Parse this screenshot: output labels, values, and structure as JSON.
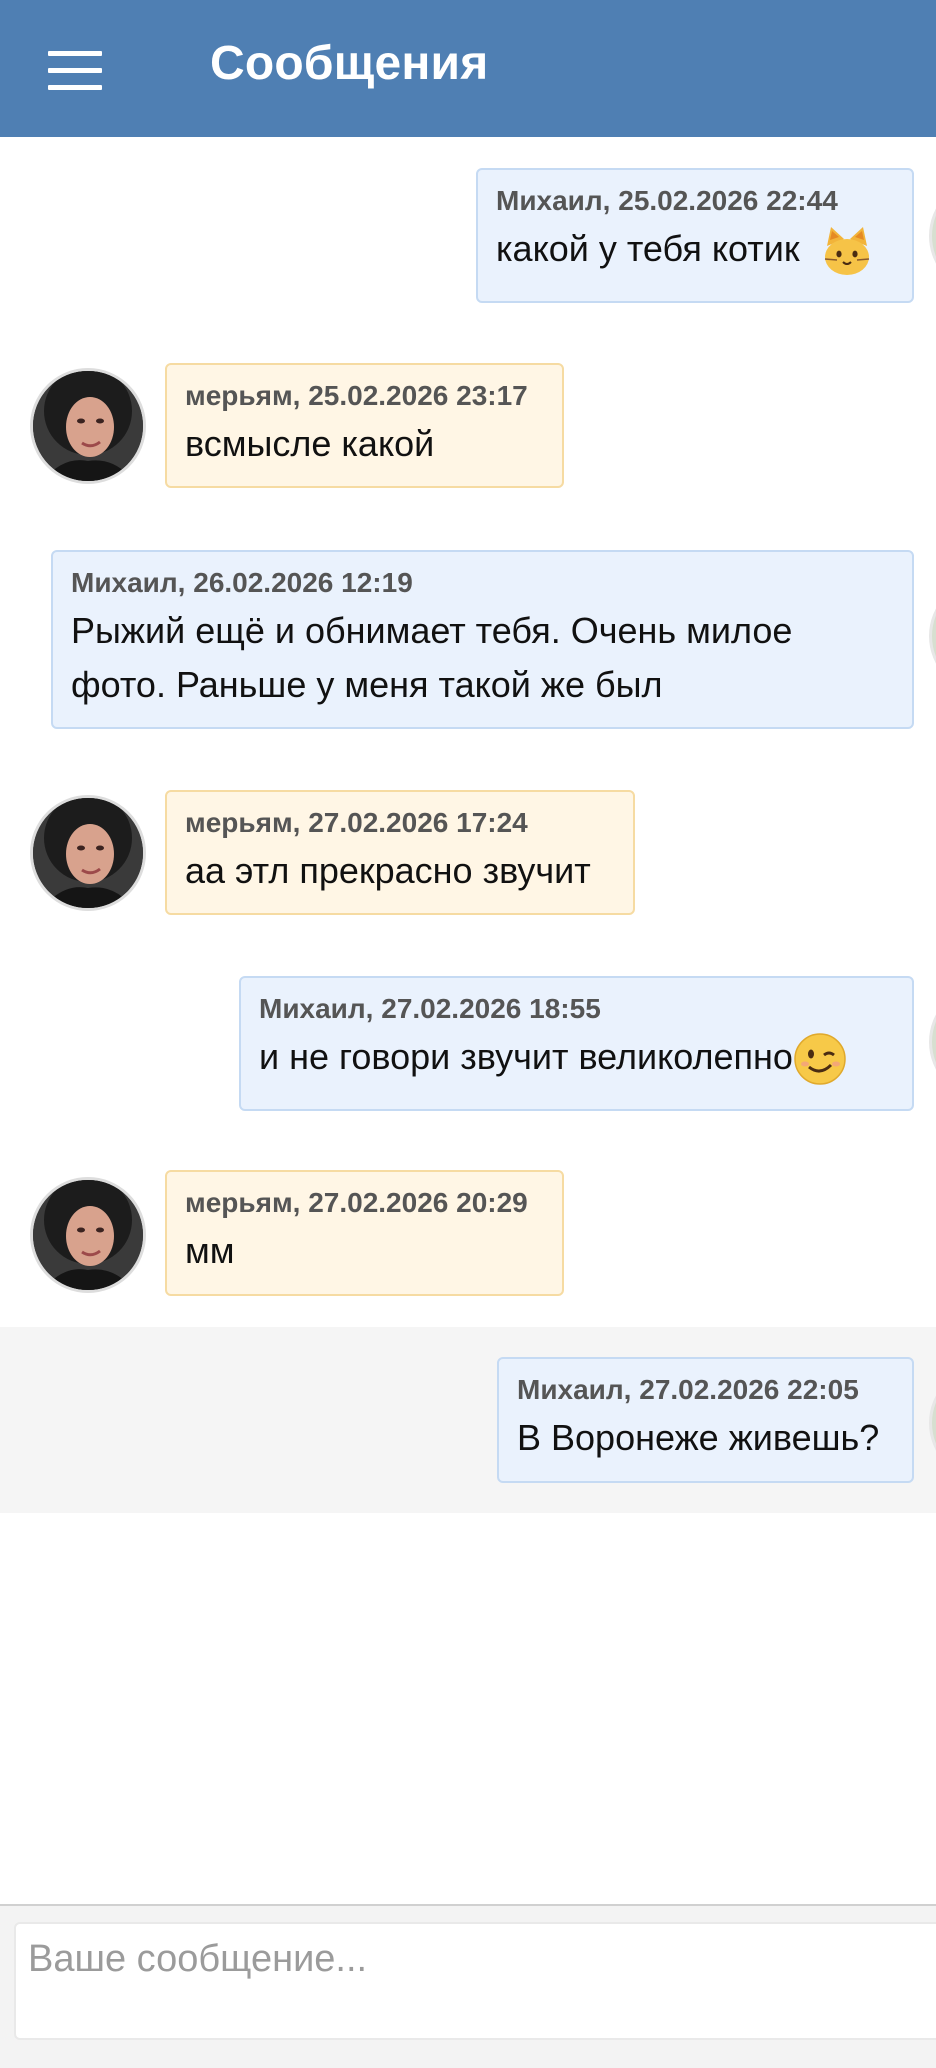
{
  "header": {
    "title": "Сообщения"
  },
  "messages": [
    {
      "direction": "out",
      "author": "Михаил",
      "meta": "Михаил, 25.02.2026 22:44",
      "text": "какой у тебя котик",
      "emoji": "cat-face-emoji"
    },
    {
      "direction": "in",
      "author": "мерьям",
      "meta": "мерьям, 25.02.2026 23:17",
      "text": "всмысле какой"
    },
    {
      "direction": "out",
      "author": "Михаил",
      "meta": "Михаил, 26.02.2026 12:19",
      "text_line1": "Рыжий ещё и обнимает тебя. Очень милое",
      "text_line2": "фото. Раньше у меня такой же был"
    },
    {
      "direction": "in",
      "author": "мерьям",
      "meta": "мерьям, 27.02.2026 17:24",
      "text": "аа этл прекрасно звучит"
    },
    {
      "direction": "out",
      "author": "Михаил",
      "meta": "Михаил, 27.02.2026 18:55",
      "text": "и не говори звучит великолепно",
      "emoji": "winking-face-emoji"
    },
    {
      "direction": "in",
      "author": "мерьям",
      "meta": "мерьям, 27.02.2026 20:29",
      "text": "мм"
    },
    {
      "direction": "out",
      "author": "Михаил",
      "meta": "Михаил, 27.02.2026 22:05",
      "text": "В Воронеже живешь?"
    }
  ],
  "composer": {
    "placeholder": "Ваше сообщение..."
  },
  "colors": {
    "header": "#4f7fb3",
    "outgoing_bubble": "#eaf2fd",
    "incoming_bubble": "#fff6e5"
  }
}
